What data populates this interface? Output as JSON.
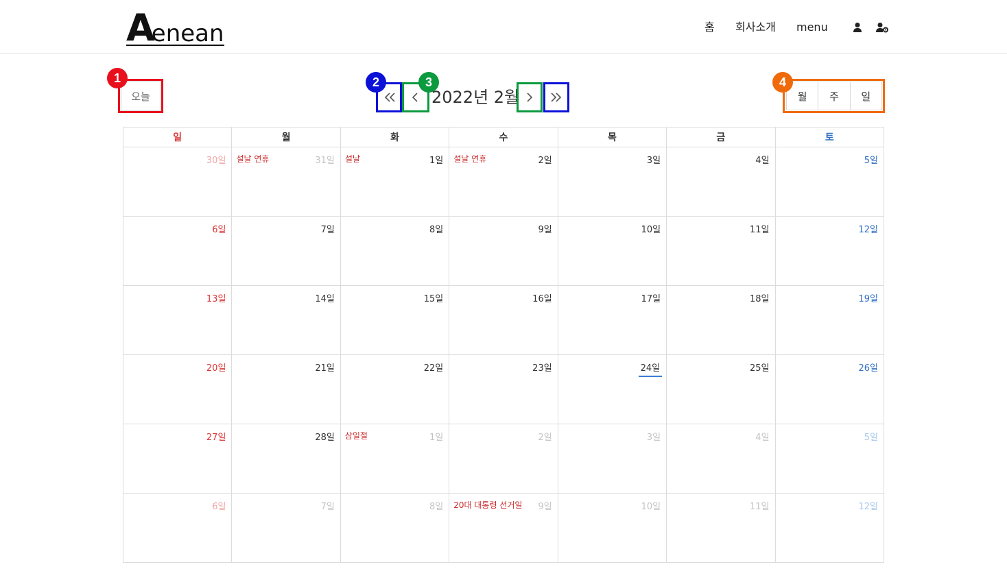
{
  "header": {
    "logo_big": "A",
    "logo_rest": "enean",
    "nav": [
      "홈",
      "회사소개",
      "menu"
    ],
    "icons": [
      "user-icon",
      "user-settings-icon"
    ]
  },
  "toolbar": {
    "today_label": "오늘",
    "prev_year_symbol": "«",
    "prev_month_symbol": "‹",
    "month_title": "2022년 2월",
    "next_month_symbol": "›",
    "next_year_symbol": "»",
    "views": [
      "월",
      "주",
      "일"
    ]
  },
  "annotations": [
    {
      "number": "1",
      "color": "#e8101c"
    },
    {
      "number": "2",
      "color": "#0c11d8"
    },
    {
      "number": "3",
      "color": "#0b9a3e"
    },
    {
      "number": "4",
      "color": "#f06a0a"
    }
  ],
  "calendar": {
    "weekdays": [
      "일",
      "월",
      "화",
      "수",
      "목",
      "금",
      "토"
    ],
    "weeks": [
      [
        {
          "day": "30일",
          "other": true
        },
        {
          "day": "31일",
          "other": true,
          "event": "설날 연휴"
        },
        {
          "day": "1일",
          "event": "설날"
        },
        {
          "day": "2일",
          "event": "설날 연휴"
        },
        {
          "day": "3일"
        },
        {
          "day": "4일"
        },
        {
          "day": "5일"
        }
      ],
      [
        {
          "day": "6일"
        },
        {
          "day": "7일"
        },
        {
          "day": "8일"
        },
        {
          "day": "9일"
        },
        {
          "day": "10일"
        },
        {
          "day": "11일"
        },
        {
          "day": "12일"
        }
      ],
      [
        {
          "day": "13일"
        },
        {
          "day": "14일"
        },
        {
          "day": "15일"
        },
        {
          "day": "16일"
        },
        {
          "day": "17일"
        },
        {
          "day": "18일"
        },
        {
          "day": "19일"
        }
      ],
      [
        {
          "day": "20일"
        },
        {
          "day": "21일"
        },
        {
          "day": "22일"
        },
        {
          "day": "23일"
        },
        {
          "day": "24일",
          "today": true
        },
        {
          "day": "25일"
        },
        {
          "day": "26일"
        }
      ],
      [
        {
          "day": "27일"
        },
        {
          "day": "28일"
        },
        {
          "day": "1일",
          "other": true,
          "event": "삼일절"
        },
        {
          "day": "2일",
          "other": true
        },
        {
          "day": "3일",
          "other": true
        },
        {
          "day": "4일",
          "other": true
        },
        {
          "day": "5일",
          "other": true
        }
      ],
      [
        {
          "day": "6일",
          "other": true
        },
        {
          "day": "7일",
          "other": true
        },
        {
          "day": "8일",
          "other": true
        },
        {
          "day": "9일",
          "other": true,
          "event": "20대 대통령 선거일"
        },
        {
          "day": "10일",
          "other": true
        },
        {
          "day": "11일",
          "other": true
        },
        {
          "day": "12일",
          "other": true
        }
      ]
    ]
  }
}
